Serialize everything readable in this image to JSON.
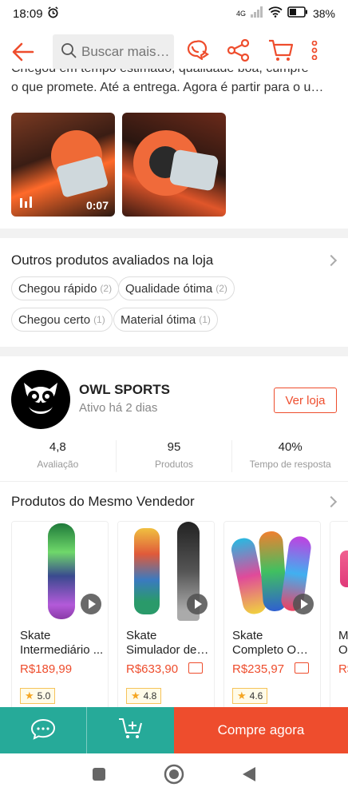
{
  "status_bar": {
    "time": "18:09",
    "network": "4G",
    "battery": "38%"
  },
  "header": {
    "search_placeholder": "Buscar mais…",
    "icons": [
      "back-arrow-icon",
      "chat-share-icon",
      "share-icon",
      "cart-icon",
      "more-vert-icon"
    ]
  },
  "review": {
    "text_line1": "Chegou em tempo estimado, qualidade boa, cumpre",
    "text_line2": "o que promete. Até a entrega. Agora é partir para o u…",
    "video_duration": "0:07"
  },
  "other_products": {
    "title": "Outros produtos avaliados na loja",
    "tags": [
      {
        "label": "Chegou rápido",
        "count": "(2)"
      },
      {
        "label": "Qualidade ótima",
        "count": "(2)"
      },
      {
        "label": "Chegou certo",
        "count": "(1)"
      },
      {
        "label": "Material ótima",
        "count": "(1)"
      }
    ]
  },
  "shop": {
    "name": "OWL SPORTS",
    "status": "Ativo há 2 dias",
    "view_button": "Ver loja",
    "stats": [
      {
        "value": "4,8",
        "label": "Avaliação"
      },
      {
        "value": "95",
        "label": "Produtos"
      },
      {
        "value": "40%",
        "label": "Tempo de resposta"
      }
    ]
  },
  "same_seller": {
    "title": "Produtos do Mesmo Vendedor",
    "products": [
      {
        "name_line1": "Skate",
        "name_line2": "Intermediário ...",
        "price": "R$189,99",
        "rating": "5.0",
        "free_shipping": false
      },
      {
        "name_line1": "Skate",
        "name_line2": "Simulador de ...",
        "price": "R$633,90",
        "rating": "4.8",
        "free_shipping": true
      },
      {
        "name_line1": "Skate",
        "name_line2": "Completo OW...",
        "price": "R$235,97",
        "rating": "4.6",
        "free_shipping": true
      },
      {
        "name_line1": "M",
        "name_line2": "O",
        "price": "R$",
        "rating": "",
        "free_shipping": false
      }
    ]
  },
  "bottom_bar": {
    "buy_label": "Compre agora"
  },
  "colors": {
    "accent": "#ee4d2d",
    "teal": "#26aa99"
  }
}
